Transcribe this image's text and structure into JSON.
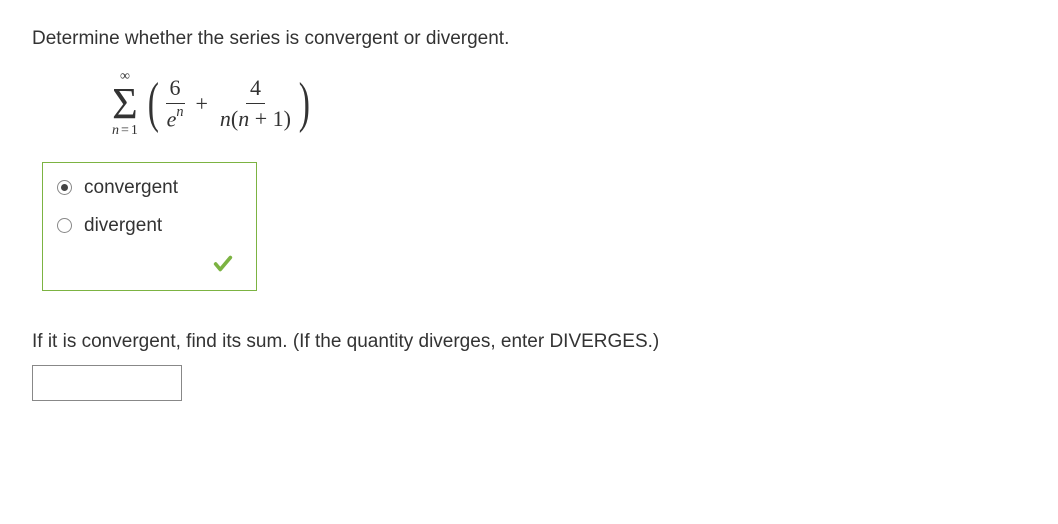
{
  "question": "Determine whether the series is convergent or divergent.",
  "formula": {
    "sigma_top": "∞",
    "sigma_var": "n",
    "sigma_eq": "=",
    "sigma_start": "1",
    "frac1_num": "6",
    "frac1_den_base": "e",
    "frac1_den_exp": "n",
    "plus": "+",
    "frac2_num": "4",
    "frac2_den": "n(n + 1)"
  },
  "options": {
    "opt1": "convergent",
    "opt2": "divergent"
  },
  "selected": "convergent",
  "followup": "If it is convergent, find its sum. (If the quantity diverges, enter DIVERGES.)",
  "answer_value": ""
}
